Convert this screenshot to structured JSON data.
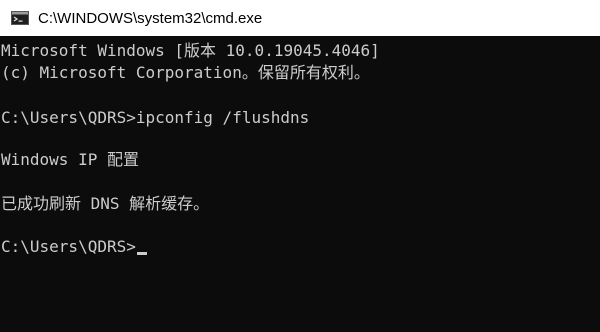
{
  "window": {
    "title": "C:\\WINDOWS\\system32\\cmd.exe",
    "icon": "cmd-console-icon"
  },
  "console": {
    "lines": [
      "Microsoft Windows [版本 10.0.19045.4046]",
      "(c) Microsoft Corporation。保留所有权利。",
      "",
      "C:\\Users\\QDRS>ipconfig /flushdns",
      "",
      "Windows IP 配置",
      "",
      "已成功刷新 DNS 解析缓存。",
      "",
      "C:\\Users\\QDRS>"
    ]
  },
  "colors": {
    "background": "#0c0c0c",
    "foreground": "#cccccc",
    "titlebar": "#ffffff"
  }
}
